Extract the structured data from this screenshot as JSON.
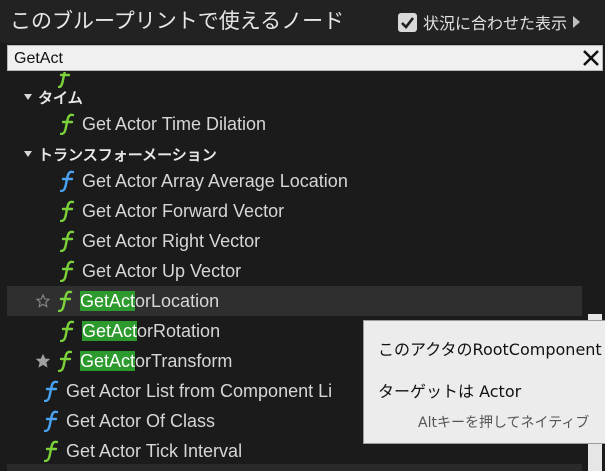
{
  "header": {
    "title": "このブループリントで使えるノード",
    "context_sensitive_label": "状況に合わせた表示",
    "context_sensitive_checked": true
  },
  "search": {
    "value": "GetAct"
  },
  "tree": {
    "categories": [
      {
        "label": "タイム",
        "items": [
          {
            "label": "Get Actor Time Dilation",
            "icon": "function-icon",
            "icon_color": "#7bd23b"
          }
        ]
      },
      {
        "label": "トランスフォーメーション",
        "items": [
          {
            "label": "Get Actor Array Average Location",
            "icon": "function-icon",
            "icon_color": "#4aa3f0"
          },
          {
            "label": "Get Actor Forward Vector",
            "icon": "function-icon",
            "icon_color": "#7bd23b"
          },
          {
            "label": "Get Actor Right Vector",
            "icon": "function-icon",
            "icon_color": "#7bd23b"
          },
          {
            "label": "Get Actor Up Vector",
            "icon": "function-icon",
            "icon_color": "#7bd23b"
          },
          {
            "match": "GetAct",
            "rest": "orLocation",
            "favorite": false,
            "icon": "function-icon",
            "icon_color": "#7bd23b"
          },
          {
            "match": "GetAct",
            "rest": "orRotation",
            "icon": "function-icon",
            "icon_color": "#7bd23b"
          },
          {
            "match": "GetAct",
            "rest": "orTransform",
            "favorite": true,
            "icon": "function-icon",
            "icon_color": "#7bd23b"
          }
        ]
      }
    ],
    "root_items": [
      {
        "label": "Get Actor List from Component Li",
        "icon": "function-icon",
        "icon_color": "#4aa3f0"
      },
      {
        "label": "Get Actor Of Class",
        "icon": "function-icon",
        "icon_color": "#4aa3f0"
      },
      {
        "label": "Get Actor Tick Interval",
        "icon": "function-icon",
        "icon_color": "#7bd23b"
      }
    ]
  },
  "tooltip": {
    "line1": "このアクタのRootComponent",
    "line2": "ターゲットは Actor",
    "line3": "Altキーを押してネイティブ"
  },
  "colors": {
    "highlight": "#2c9a2c",
    "function_green": "#7bd23b",
    "function_blue": "#4aa3f0"
  }
}
